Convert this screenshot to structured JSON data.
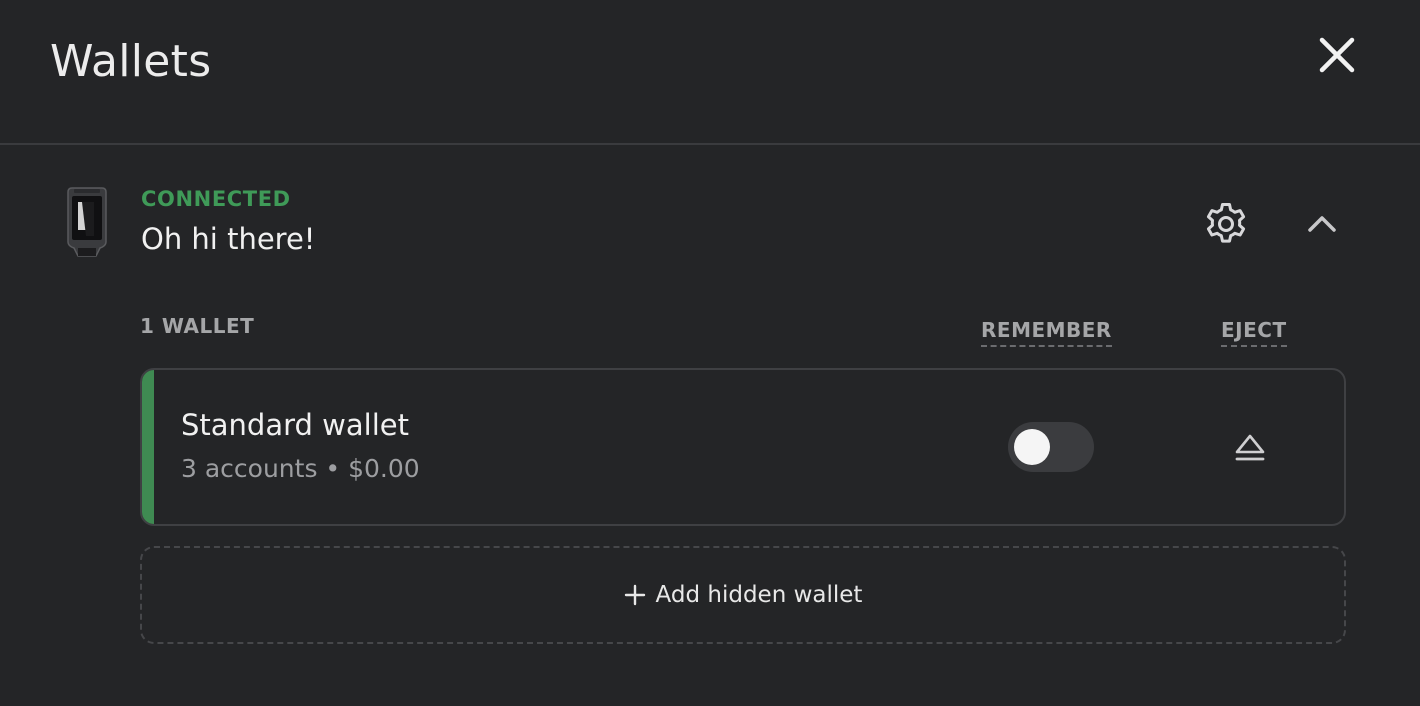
{
  "header": {
    "title": "Wallets",
    "close_icon": "close-icon"
  },
  "device": {
    "status": "CONNECTED",
    "status_color": "#3f9a58",
    "name": "Oh hi there!",
    "settings_icon": "gear-icon",
    "collapse_icon": "chevron-up-icon"
  },
  "wallets_section": {
    "count_label": "1 WALLET",
    "remember_label": "REMEMBER",
    "eject_label": "EJECT",
    "items": [
      {
        "name": "Standard wallet",
        "meta": "3 accounts • $0.00",
        "remember": false,
        "accent_color": "#3f8a52",
        "eject_icon": "eject-icon"
      }
    ],
    "add_hidden_label": "Add hidden wallet",
    "add_icon": "plus-icon"
  }
}
